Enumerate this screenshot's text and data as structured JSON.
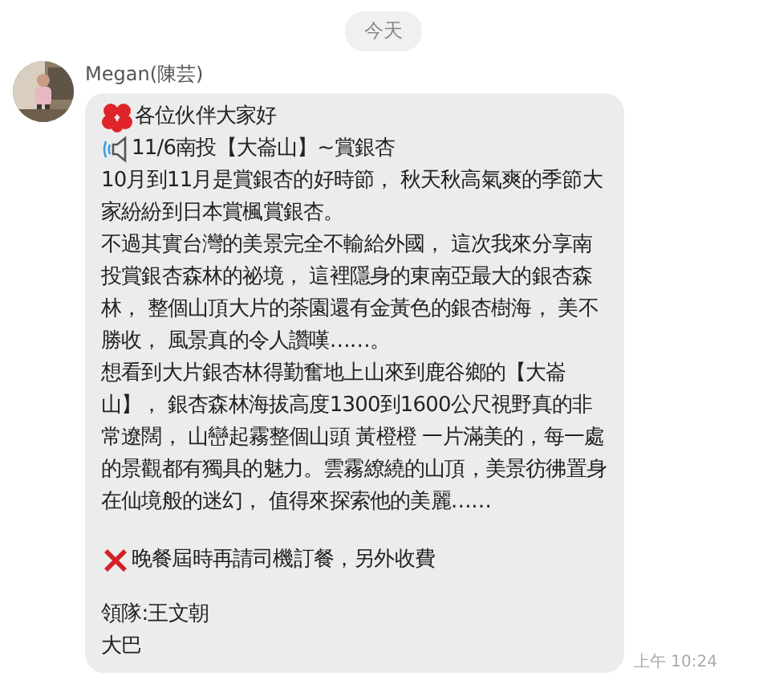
{
  "date_chip": "今天",
  "message": {
    "sender": "Megan(陳芸)",
    "time": "上午 10:24",
    "blocks": [
      {
        "kind": "flower",
        "text": "各位伙伴大家好"
      },
      {
        "kind": "speaker",
        "text": "11/6南投【大崙山】~賞銀杏"
      },
      {
        "kind": "text",
        "text": "10月到11月是賞銀杏的好時節， 秋天秋高氣爽的季節大家紛紛到日本賞楓賞銀杏。"
      },
      {
        "kind": "text",
        "text": "不過其實台灣的美景完全不輸給外國， 這次我來分享南投賞銀杏森林的祕境， 這裡隱身的東南亞最大的銀杏森林， 整個山頂大片的茶園還有金黃色的銀杏樹海， 美不勝收， 風景真的令人讚嘆……。"
      },
      {
        "kind": "text",
        "text": "想看到大片銀杏林得勤奮地上山來到鹿谷鄉的【大崙山】， 銀杏森林海拔高度1300到1600公尺視野真的非常遼闊， 山巒起霧整個山頭 黃橙橙 一片滿美的，每一處的景觀都有獨具的魅力。雲霧繚繞的山頂，美景彷彿置身在仙境般的迷幻， 值得來探索他的美麗……"
      },
      {
        "kind": "cross",
        "text": "晚餐屆時再請司機訂餐，另外收費"
      },
      {
        "kind": "spaced",
        "text": "領隊:王文朝"
      },
      {
        "kind": "text",
        "text": "大巴"
      }
    ]
  }
}
